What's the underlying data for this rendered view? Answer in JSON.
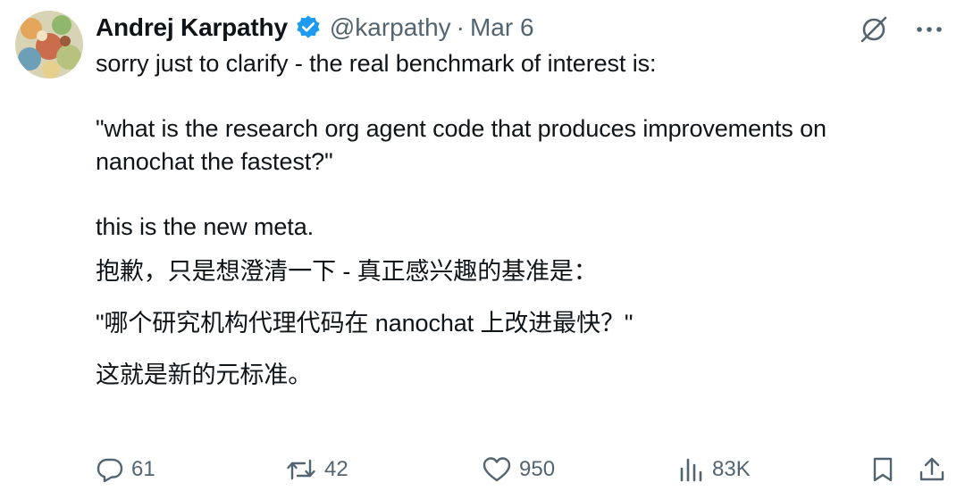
{
  "author": {
    "name": "Andrej Karpathy",
    "handle": "@karpathy",
    "separator": "·",
    "date": "Mar 6",
    "verified_color": "#1d9bf0"
  },
  "post": {
    "line1": "sorry just to clarify - the real benchmark of interest is:",
    "line2": "\"what is the research org agent code that produces improvements on nanochat the fastest?\"",
    "line3": "this is the new meta.",
    "translation1": "抱歉，只是想澄清一下 - 真正感兴趣的基准是：",
    "translation2": "\"哪个研究机构代理代码在 nanochat 上改进最快？\"",
    "translation3": "这就是新的元标准。"
  },
  "top_icons": [
    "grok-icon",
    "more-icon"
  ],
  "actions": {
    "replies": "61",
    "reposts": "42",
    "likes": "950",
    "views": "83K"
  },
  "colors": {
    "text": "#0f1419",
    "muted": "#536471",
    "accent": "#1d9bf0"
  }
}
